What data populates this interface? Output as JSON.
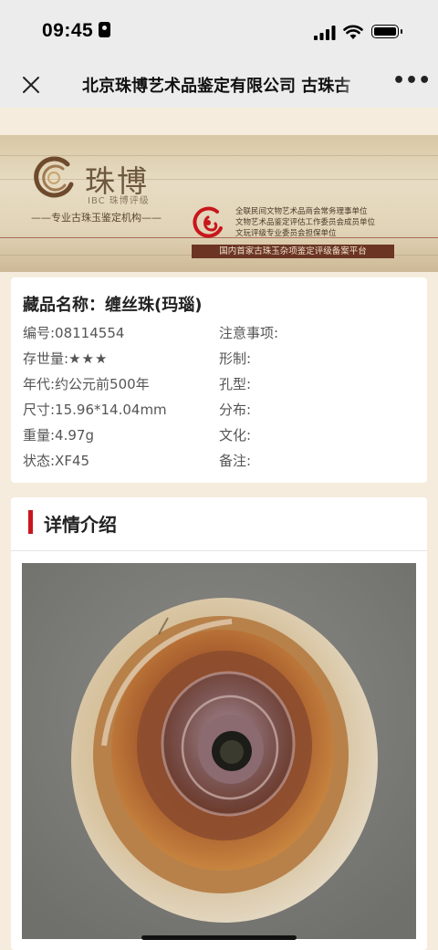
{
  "status_bar": {
    "time": "09:45"
  },
  "nav": {
    "title": "北京珠博艺术品鉴定有限公司 古珠古",
    "more_label": "•••"
  },
  "banner": {
    "logo_name": "珠博",
    "logo_sub": "IBC 珠博评级",
    "slogan": "——专业古珠玉鉴定机构——",
    "cert_lines": [
      "全联民间文物艺术品商会常务理事单位",
      "文物艺术品鉴定评估工作委员会成员单位",
      "文玩评级专业委员会担保单位"
    ],
    "cert_tag": "国内首家古珠玉杂项鉴定评级备案平台",
    "accent_color": "#c8161d"
  },
  "item": {
    "title": "藏品名称：缠丝珠(玛瑙)",
    "left": [
      "编号:08114554",
      "存世量:",
      "年代:约公元前500年",
      "尺寸:15.96*14.04mm",
      "重量:4.97g",
      "状态:XF45"
    ],
    "stars": "★★★",
    "right": [
      "注意事项:",
      "形制:",
      "孔型:",
      "分布:",
      "文化:",
      "备注:"
    ]
  },
  "details": {
    "title": "详情介绍"
  }
}
